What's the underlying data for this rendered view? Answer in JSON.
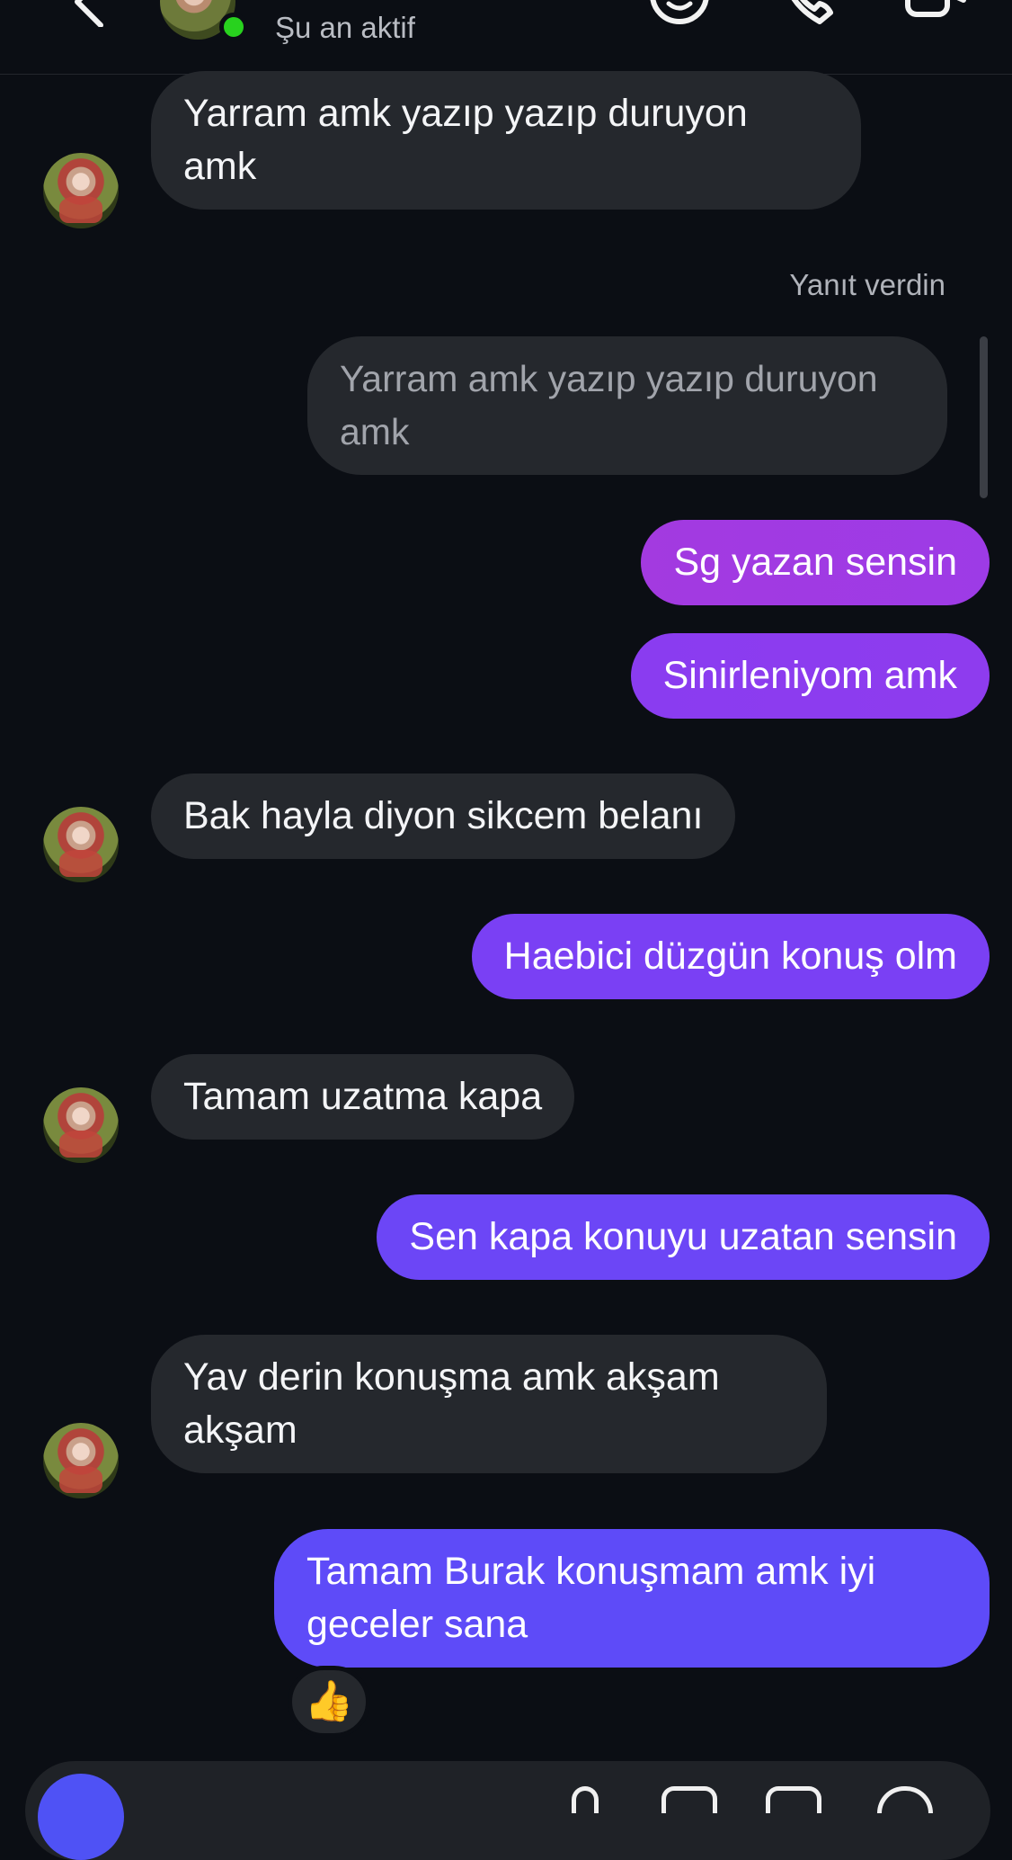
{
  "header": {
    "status_text": "Şu an aktif",
    "icons": [
      "back-chevron",
      "sticker-face-icon",
      "phone-icon",
      "video-camera-icon"
    ],
    "active_color": "#28d21e"
  },
  "messages": [
    {
      "sender": "them",
      "text": "Yarram amk yazıp yazıp duruyon amk"
    },
    {
      "sender": "me",
      "reply_label": "Yanıt verdin",
      "quoted_text": "Yarram amk yazıp yazıp duruyon amk"
    },
    {
      "sender": "me",
      "text": "Sg yazan sensin"
    },
    {
      "sender": "me",
      "text": "Sinirleniyom amk"
    },
    {
      "sender": "them",
      "text": "Bak hayla diyon sikcem belanı"
    },
    {
      "sender": "me",
      "text": "Haebici düzgün konuş olm"
    },
    {
      "sender": "them",
      "text": "Tamam uzatma kapa"
    },
    {
      "sender": "me",
      "text": "Sen kapa konuyu uzatan sensin"
    },
    {
      "sender": "them",
      "text": "Yav derin konuşma amk akşam akşam"
    },
    {
      "sender": "me",
      "text": "Tamam Burak konuşmam amk iyi geceler sana",
      "reaction": "👍"
    }
  ],
  "colors": {
    "background": "#0b0e14",
    "incoming_bubble": "#25282d",
    "outgoing_gradient": [
      "#a33ae0",
      "#8a3cf0",
      "#7a40f4",
      "#6c46f6",
      "#6548f7",
      "#5e4bf8"
    ],
    "composer_button": "#4f52f5"
  }
}
